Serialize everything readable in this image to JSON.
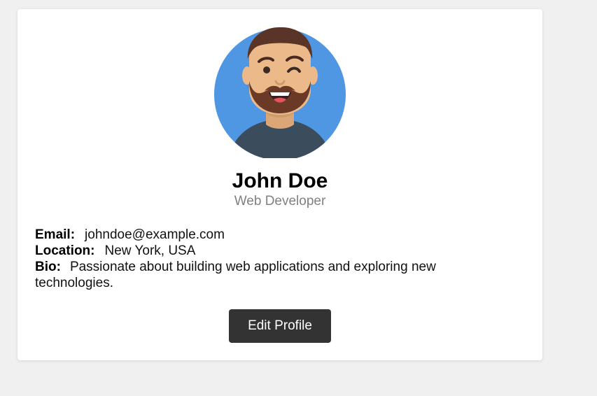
{
  "profile": {
    "avatar_alt": "avatar",
    "name": "John Doe",
    "title": "Web Developer",
    "email_label": "Email:",
    "email": "johndoe@example.com",
    "location_label": "Location:",
    "location": "New York, USA",
    "bio_label": "Bio:",
    "bio": "Passionate about building web applications and exploring new technologies.",
    "edit_label": "Edit Profile"
  },
  "colors": {
    "page_bg": "#f0f0f0",
    "card_bg": "#ffffff",
    "avatar_circle": "#4f97e3",
    "shirt": "#3b4c5c",
    "skin": "#ecba8a",
    "hair": "#5a3426",
    "button_bg": "#333333",
    "subtitle": "#808080"
  }
}
